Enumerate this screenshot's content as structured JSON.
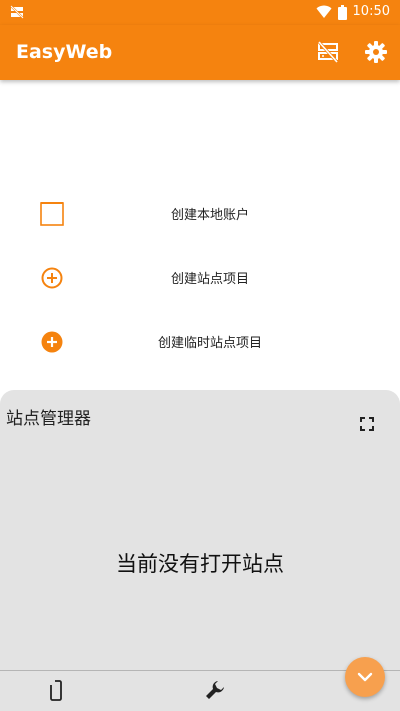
{
  "status_bar": {
    "time": "10:50",
    "left_icon": "notification-off-icon",
    "wifi_icon": "wifi-icon",
    "battery_icon": "battery-icon"
  },
  "app_bar": {
    "title": "EasyWeb",
    "actions": [
      "server-off-icon",
      "gear-icon"
    ]
  },
  "menu": {
    "items": [
      {
        "label": "创建本地账户",
        "icon": "bracket-square-icon"
      },
      {
        "label": "创建站点项目",
        "icon": "plus-circle-outline-icon"
      },
      {
        "label": "创建临时站点项目",
        "icon": "plus-circle-filled-icon"
      }
    ]
  },
  "site_manager": {
    "title": "站点管理器",
    "empty_text": "当前没有打开站点"
  },
  "bottom_bar": {
    "icons": [
      "phone-icon",
      "wrench-icon",
      "chevron-down-icon"
    ]
  },
  "colors": {
    "accent": "#f5830f",
    "fab": "#f7a04e",
    "panel_bg": "#e3e3e3"
  }
}
